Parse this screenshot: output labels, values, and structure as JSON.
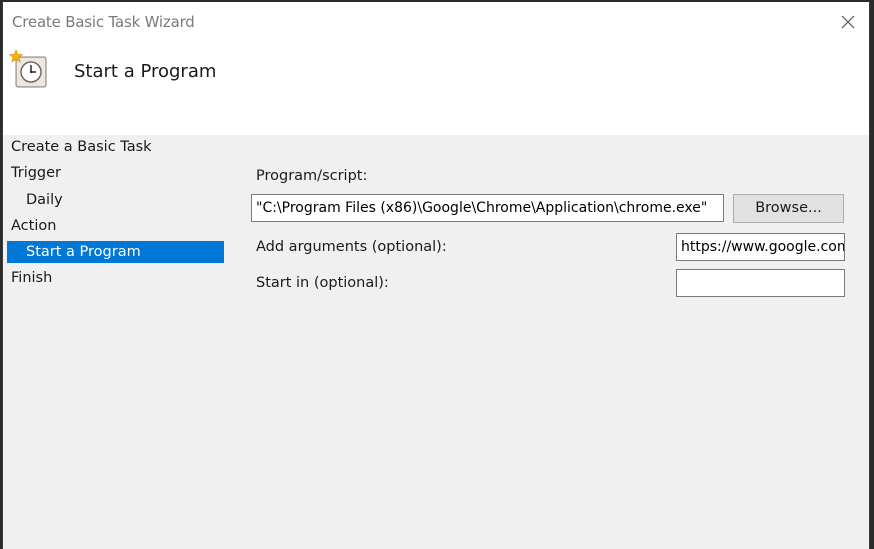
{
  "window": {
    "title": "Create Basic Task Wizard"
  },
  "header": {
    "title": "Start a Program",
    "icon": "task-scheduler-clock-icon"
  },
  "nav": {
    "items": [
      {
        "label": "Create a Basic Task",
        "selected": false
      },
      {
        "label": "Trigger",
        "selected": false
      },
      {
        "label": "Daily",
        "selected": false
      },
      {
        "label": "Action",
        "selected": false
      },
      {
        "label": "Start a Program",
        "selected": true
      },
      {
        "label": "Finish",
        "selected": false
      }
    ]
  },
  "form": {
    "program_label": "Program/script:",
    "program_value": "\"C:\\Program Files (x86)\\Google\\Chrome\\Application\\chrome.exe\"",
    "browse_label": "Browse...",
    "arguments_label": "Add arguments (optional):",
    "arguments_value": "https://www.google.com/",
    "start_in_label": "Start in (optional):",
    "start_in_value": ""
  },
  "colors": {
    "selection": "#0078d7",
    "panel_background": "#f0f0f0",
    "header_background": "#ffffff"
  }
}
